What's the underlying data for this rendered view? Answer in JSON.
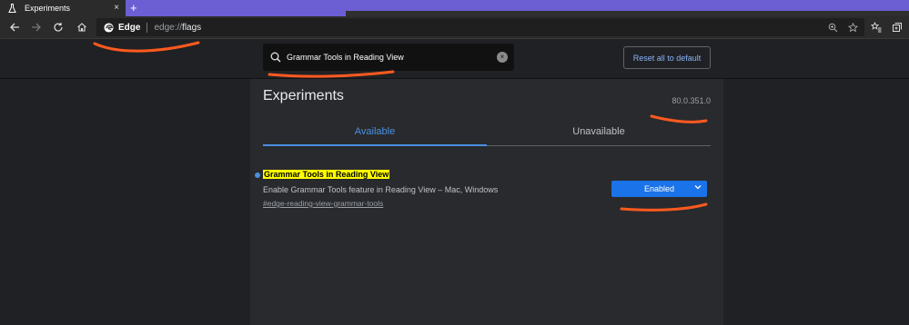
{
  "browser": {
    "tab": {
      "title": "Experiments",
      "close": "×"
    },
    "new_tab": "+",
    "omnibox": {
      "site_label": "Edge",
      "url_prefix": "edge://",
      "url_path": "flags"
    }
  },
  "header": {
    "search": {
      "value": "Grammar Tools in Reading View",
      "clear": "×"
    },
    "reset_label": "Reset all to default"
  },
  "page": {
    "title": "Experiments",
    "version": "80.0.351.0",
    "tabs": [
      {
        "label": "Available",
        "selected": true
      },
      {
        "label": "Unavailable",
        "selected": false
      }
    ],
    "flag": {
      "name": "Grammar Tools in Reading View",
      "description": "Enable Grammar Tools feature in Reading View – Mac, Windows",
      "link": "#edge-reading-view-grammar-tools",
      "value": "Enabled"
    }
  },
  "colors": {
    "tabbar": "#6b5fd3",
    "accent": "#4a90e2",
    "highlight": "#ffff00",
    "annotation": "#ff5a1f"
  }
}
